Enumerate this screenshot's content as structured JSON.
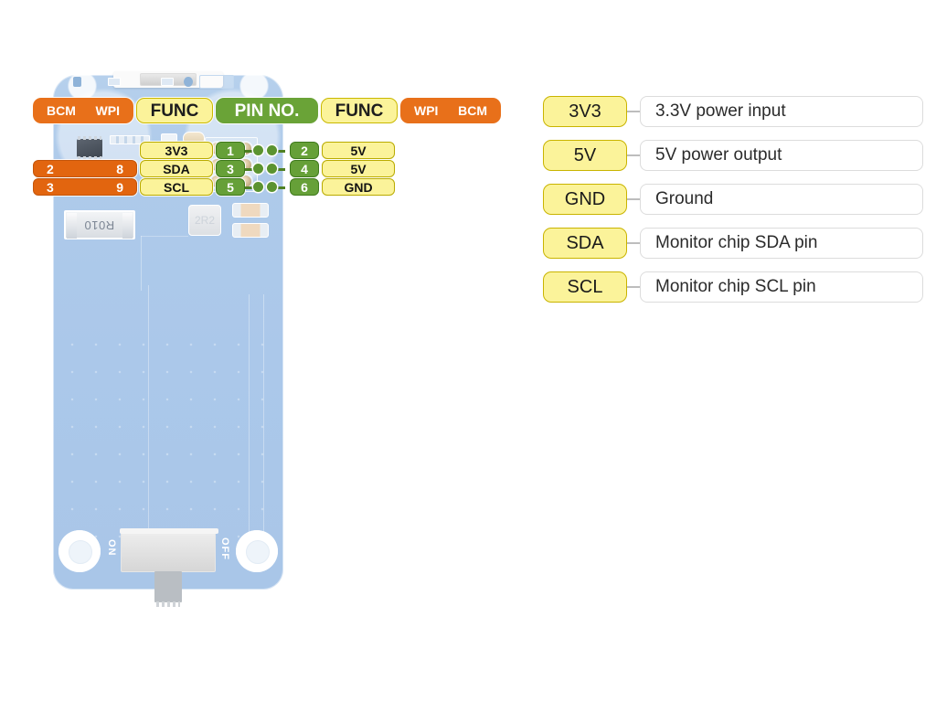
{
  "diagram": {
    "title": "Raspberry Pi UPS HAT pinout diagram",
    "colors": {
      "orange": "#e8701a",
      "green": "#6aa337",
      "yellow": "#fbf39a",
      "pcb_blue": "#abc8ea"
    }
  },
  "headers": {
    "left_bcm": "BCM",
    "left_wpi": "WPI",
    "left_func": "FUNC",
    "pin_no": "PIN NO.",
    "right_func": "FUNC",
    "right_wpi": "WPI",
    "right_bcm": "BCM"
  },
  "pins": [
    {
      "left_bcm": "",
      "left_wpi": "",
      "left_func": "3V3",
      "left_pin": "1",
      "right_pin": "2",
      "right_func": "5V",
      "right_wpi": "",
      "right_bcm": "",
      "has_left_bcm_badge": false
    },
    {
      "left_bcm": "2",
      "left_wpi": "8",
      "left_func": "SDA",
      "left_pin": "3",
      "right_pin": "4",
      "right_func": "5V",
      "right_wpi": "",
      "right_bcm": "",
      "has_left_bcm_badge": true
    },
    {
      "left_bcm": "3",
      "left_wpi": "9",
      "left_func": "SCL",
      "left_pin": "5",
      "right_pin": "6",
      "right_func": "GND",
      "right_wpi": "",
      "right_bcm": "",
      "has_left_bcm_badge": true
    }
  ],
  "legend": [
    {
      "key": "3V3",
      "desc": "3.3V power input"
    },
    {
      "key": "5V",
      "desc": "5V power output"
    },
    {
      "key": "GND",
      "desc": "Ground"
    },
    {
      "key": "SDA",
      "desc": "Monitor chip SDA pin"
    },
    {
      "key": "SCL",
      "desc": "Monitor chip SCL pin"
    }
  ],
  "board": {
    "resistor_marking": "R010",
    "inductor_marking": "2R2",
    "switch_on_label": "ON",
    "switch_off_label": "OFF"
  }
}
